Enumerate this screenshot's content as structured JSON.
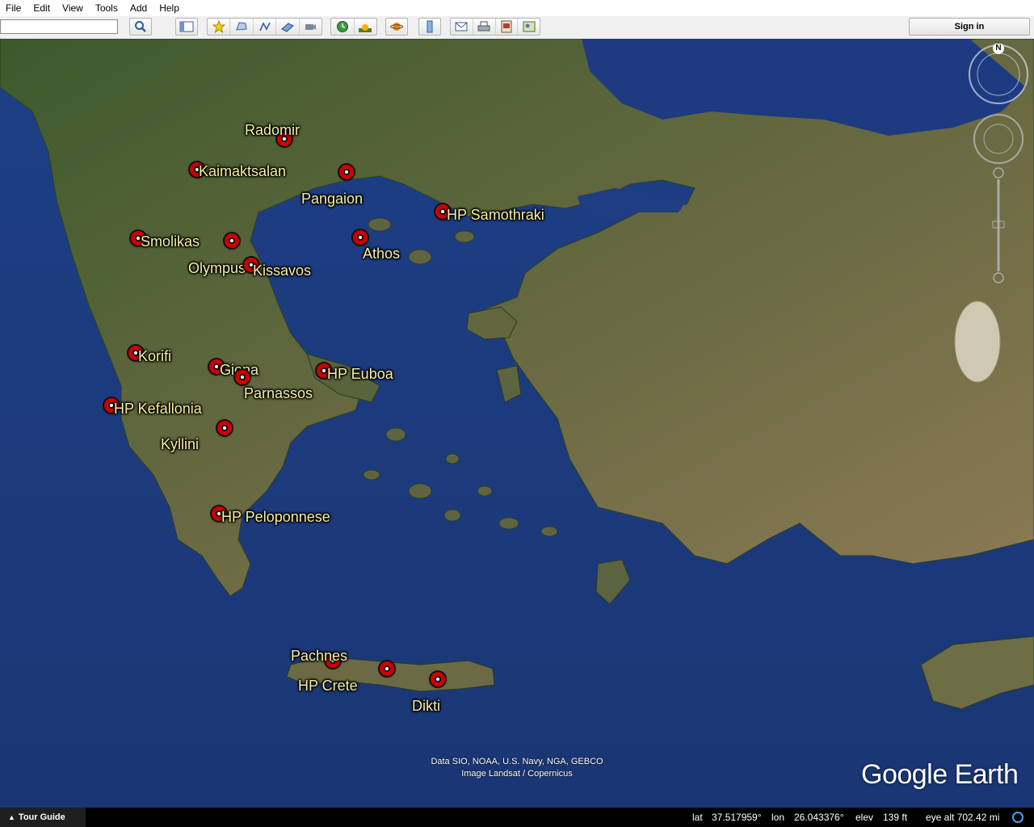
{
  "menu": [
    "File",
    "Edit",
    "View",
    "Tools",
    "Add",
    "Help"
  ],
  "search": {
    "value": "",
    "placeholder": ""
  },
  "toolbar": {
    "sign_in_label": "Sign in",
    "icons": [
      "search-icon",
      "sidebar-toggle-icon",
      "add-placemark-icon",
      "add-polygon-icon",
      "add-path-icon",
      "add-image-overlay-icon",
      "record-tour-icon",
      "historical-imagery-icon",
      "sunlight-icon",
      "switch-planet-icon",
      "ruler-icon",
      "email-icon",
      "print-icon",
      "save-image-icon",
      "view-in-maps-icon"
    ]
  },
  "placemarks": [
    {
      "name": "Radomir"
    },
    {
      "name": "Kaimaktsalan"
    },
    {
      "name": "Pangaion"
    },
    {
      "name": "HP Samothraki"
    },
    {
      "name": "Smolikas"
    },
    {
      "name": "Olympus"
    },
    {
      "name": "Kissavos"
    },
    {
      "name": "Athos"
    },
    {
      "name": "Korifi"
    },
    {
      "name": "Giona"
    },
    {
      "name": "Parnassos"
    },
    {
      "name": "HP Euboa"
    },
    {
      "name": "HP Kefallonia"
    },
    {
      "name": "Kyllini"
    },
    {
      "name": "HP Peloponnese"
    },
    {
      "name": "Pachnes"
    },
    {
      "name": "HP Crete"
    },
    {
      "name": "Dikti"
    }
  ],
  "attribution": {
    "line1": "Data SIO, NOAA, U.S. Navy, NGA, GEBCO",
    "line2": "Image Landsat / Copernicus"
  },
  "logo": "Google Earth",
  "compass": {
    "north": "N"
  },
  "status": {
    "tour_guide": "Tour Guide",
    "lat_label": "lat",
    "lat_value": "37.517959°",
    "lon_label": "lon",
    "lon_value": "26.043376°",
    "elev_label": "elev",
    "elev_value": "139 ft",
    "eye_alt": "eye alt 702.42 mi"
  },
  "colors": {
    "sea": "#1c3b7c",
    "land": "#5a6a3a",
    "label": "#f7f0a0",
    "pin": "#cc0000"
  }
}
